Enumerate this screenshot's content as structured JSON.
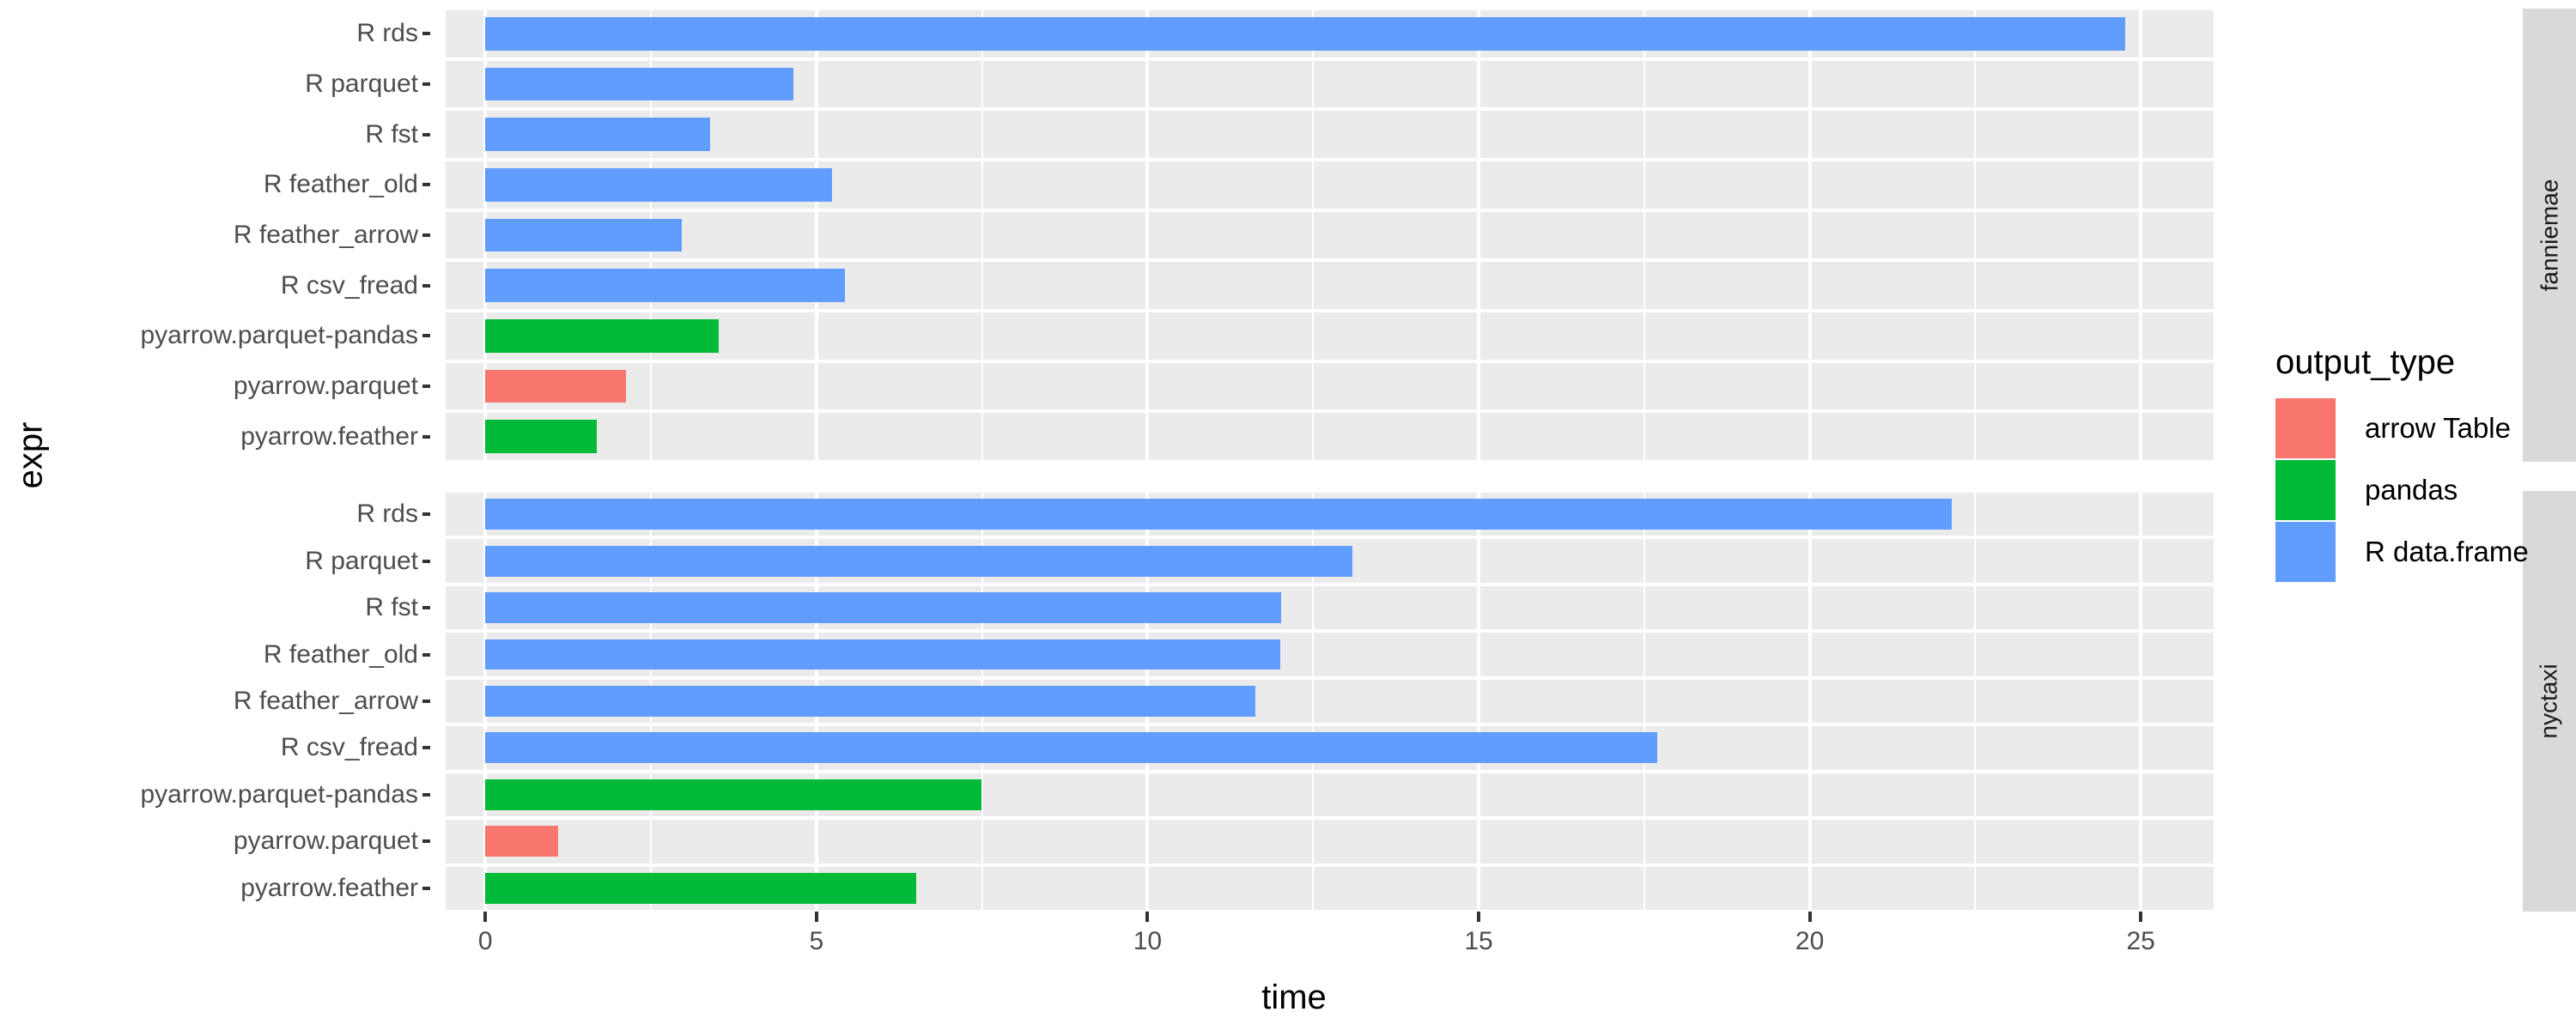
{
  "chart_data": {
    "type": "bar",
    "title": "",
    "xlabel": "time",
    "ylabel": "expr",
    "xlim": [
      -0.6,
      26.1
    ],
    "orientation": "horizontal",
    "grid": true,
    "x_ticks": [
      0,
      5,
      10,
      15,
      20,
      25
    ],
    "x_tick_labels": [
      "0",
      "5",
      "10",
      "15",
      "20",
      "25"
    ],
    "x_minor_ticks": [
      2.5,
      7.5,
      12.5,
      17.5,
      22.5
    ],
    "categories": [
      "R rds",
      "R parquet",
      "R fst",
      "R feather_old",
      "R feather_arrow",
      "R csv_fread",
      "pyarrow.parquet-pandas",
      "pyarrow.parquet",
      "pyarrow.feather"
    ],
    "facets": [
      {
        "label": "fanniemae",
        "values": [
          24.76,
          4.65,
          3.39,
          5.23,
          2.97,
          5.43,
          3.52,
          2.12,
          1.68
        ],
        "groups": [
          "R data.frame",
          "R data.frame",
          "R data.frame",
          "R data.frame",
          "R data.frame",
          "R data.frame",
          "pandas",
          "arrow Table",
          "pandas"
        ]
      },
      {
        "label": "nyctaxi",
        "values": [
          22.15,
          13.09,
          12.02,
          12.0,
          11.63,
          17.7,
          7.49,
          1.1,
          6.51
        ],
        "groups": [
          "R data.frame",
          "R data.frame",
          "R data.frame",
          "R data.frame",
          "R data.frame",
          "R data.frame",
          "pandas",
          "arrow Table",
          "pandas"
        ]
      }
    ],
    "legend": {
      "title": "output_type",
      "position": "right",
      "entries": [
        {
          "label": "arrow Table",
          "color": "#F8766D"
        },
        {
          "label": "pandas",
          "color": "#00BA38"
        },
        {
          "label": "R data.frame",
          "color": "#619CFF"
        }
      ]
    },
    "colors": {
      "arrow Table": "#F8766D",
      "pandas": "#00BA38",
      "R data.frame": "#619CFF",
      "panel_background": "#EBEBEB",
      "grid": "#FFFFFF",
      "strip_background": "#D9D9D9",
      "text": "#4D4D4D"
    }
  }
}
